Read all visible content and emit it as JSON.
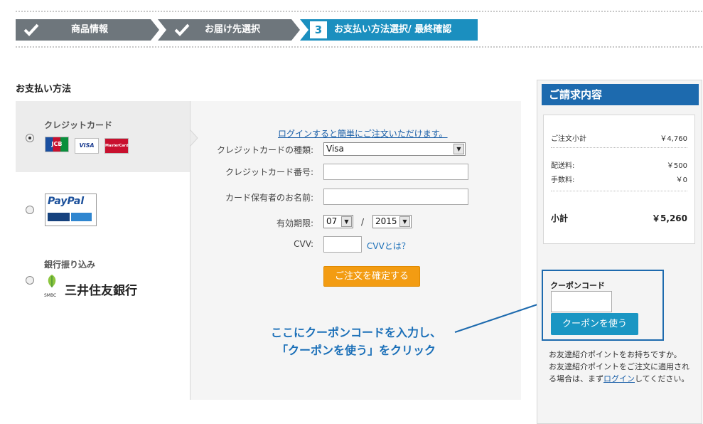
{
  "steps": [
    {
      "label": "商品情報",
      "state": "done"
    },
    {
      "label": "お届け先選択",
      "state": "done"
    },
    {
      "number": "3",
      "label": "お支払い方法選択/ 最終確認",
      "state": "current"
    }
  ],
  "payment": {
    "section_title": "お支払い方法",
    "methods": [
      {
        "label": "クレジットカード",
        "selected": true,
        "logos": [
          "JCB",
          "VISA",
          "MasterCard"
        ]
      },
      {
        "label": "",
        "selected": false,
        "logo_text": "PayPal"
      },
      {
        "label": "銀行振り込み",
        "selected": false,
        "logo_text": "三井住友銀行",
        "logo_sub": "SMBC"
      }
    ],
    "form": {
      "login_link": "ログインすると簡単にご注文いただけます。",
      "card_type_label": "クレジットカードの種類:",
      "card_type_value": "Visa",
      "card_number_label": "クレジットカード番号:",
      "card_holder_label": "カード保有者のお名前:",
      "expiry_label": "有効期限:",
      "expiry_month": "07",
      "expiry_separator": "/",
      "expiry_year": "2015",
      "cvv_label": "CVV:",
      "cvv_link": "CVVとは？",
      "confirm_button": "ご注文を確定する"
    }
  },
  "annotation": {
    "line1": "ここにクーポンコードを入力し、",
    "line2": "「クーポンを使う」をクリック"
  },
  "sidebar": {
    "title": "ご請求内容",
    "bill": {
      "subtotal_label": "ご注文小計",
      "subtotal_value": "￥4,760",
      "shipping_label": "配送料:",
      "shipping_value": "￥500",
      "fee_label": "手数料:",
      "fee_value": "￥0",
      "total_label": "小計",
      "total_value": "￥5,260"
    },
    "coupon": {
      "label": "クーポンコード",
      "button": "クーポンを使う"
    },
    "referral": {
      "text1": "お友達紹介ポイントをお持ちですか。",
      "text2": "お友達紹介ポイントをご注文に適用される場合は、まず",
      "link": "ログイン",
      "text3": "してください。"
    }
  },
  "colors": {
    "step_done": "#6e767c",
    "step_current": "#1b8fbf",
    "accent_blue": "#1d6aae",
    "confirm_orange": "#f39c12"
  }
}
